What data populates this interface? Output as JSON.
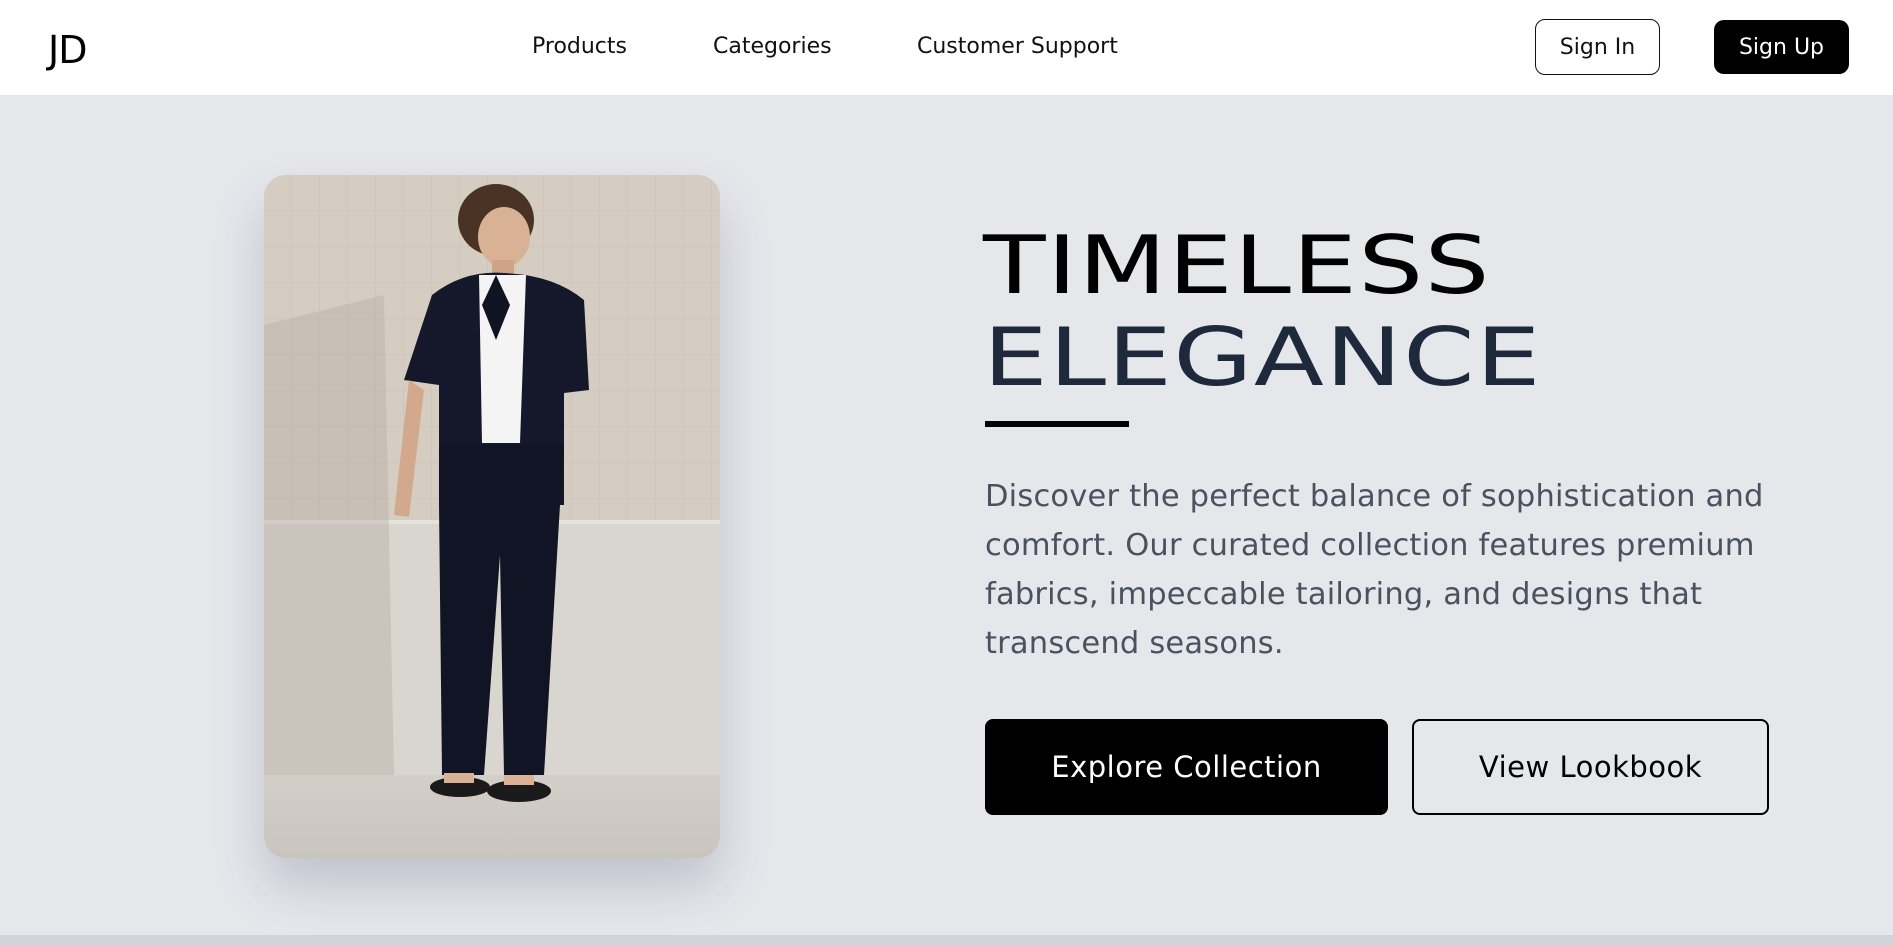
{
  "brand": {
    "logo_text": "JD"
  },
  "nav": {
    "items": [
      {
        "label": "Products"
      },
      {
        "label": "Categories"
      },
      {
        "label": "Customer Support"
      }
    ]
  },
  "auth": {
    "sign_in_label": "Sign In",
    "sign_up_label": "Sign Up"
  },
  "hero": {
    "title_line1": "TIMELESS",
    "title_line2": "ELEGANCE",
    "description_lines": [
      "Discover the perfect balance of sophistication and",
      "comfort. Our curated collection features premium",
      "fabrics, impeccable tailoring, and designs that",
      "transcend seasons."
    ],
    "primary_cta": "Explore Collection",
    "secondary_cta": "View Lookbook"
  },
  "colors": {
    "page_background": "#e5e7eb",
    "header_background": "#ffffff",
    "primary": "#000000",
    "title_accent": "#1e293b",
    "body_text": "#4a5261"
  }
}
